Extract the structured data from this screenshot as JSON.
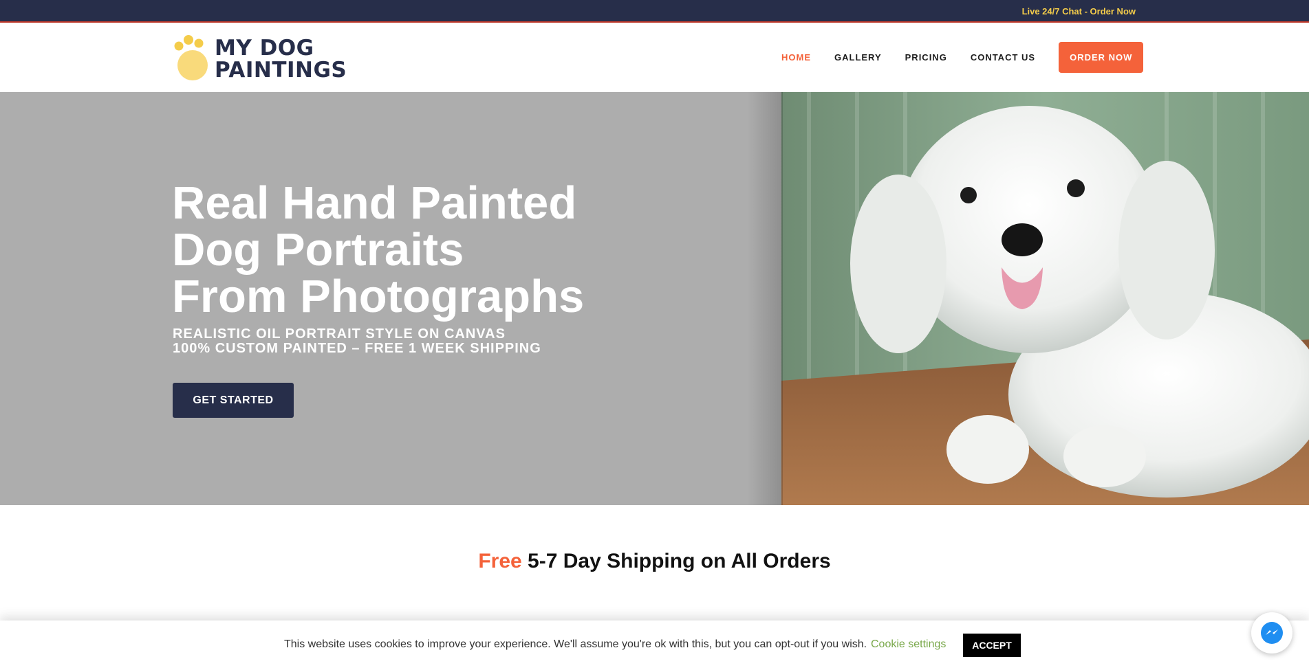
{
  "topbar": {
    "link": "Live 24/7 Chat - Order Now"
  },
  "logo": {
    "line1": "MY DOG",
    "line2": "PAINTINGS"
  },
  "nav": {
    "items": [
      {
        "label": "HOME",
        "active": true
      },
      {
        "label": "GALLERY",
        "active": false
      },
      {
        "label": "PRICING",
        "active": false
      },
      {
        "label": "CONTACT US",
        "active": false
      }
    ],
    "order_button": "ORDER NOW"
  },
  "hero": {
    "title_line1": "Real Hand Painted",
    "title_line2": "Dog Portraits",
    "title_line3": "From Photographs",
    "subtitle_line1": "REALISTIC OIL PORTRAIT STYLE ON CANVAS",
    "subtitle_line2": "100% CUSTOM PAINTED – FREE 1 WEEK SHIPPING",
    "button": "GET STARTED",
    "image": "white-maltese-dog-photo"
  },
  "shipping": {
    "accent": "Free",
    "rest": "5-7 Day Shipping on All Orders"
  },
  "cookie": {
    "text": "This website uses cookies to improve your experience. We'll assume you're ok with this, but you can opt-out if you wish.",
    "settings": "Cookie settings",
    "accept": "ACCEPT"
  },
  "colors": {
    "navy": "#272e4a",
    "accent": "#f4623a",
    "yellow": "#f4cc4a",
    "hero_bg": "#adadad",
    "cookie_link": "#79a84a"
  },
  "icons": {
    "messenger": "messenger-icon",
    "logo": "paw-icon"
  }
}
